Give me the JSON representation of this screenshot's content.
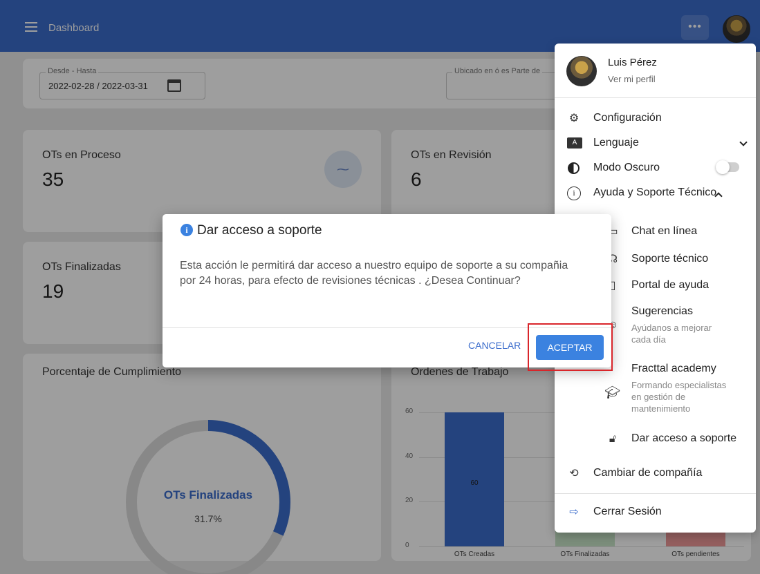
{
  "topbar": {
    "title": "Dashboard",
    "more_label": "•••"
  },
  "filters": {
    "date_range_label": "Desde - Hasta",
    "date_range_value": "2022-02-28 / 2022-03-31",
    "location_label": "Ubicado en ó es Parte de"
  },
  "cards": {
    "in_process": {
      "title": "OTs en Proceso",
      "value": "35"
    },
    "in_review": {
      "title": "OTs en Revisión",
      "value": "6"
    },
    "finished": {
      "title": "OTs Finalizadas",
      "value": "19"
    },
    "compliance": {
      "title": "Porcentaje de Cumplimiento",
      "donut_label": "OTs Finalizadas",
      "donut_percent": "31.7%",
      "donut_fraction": 0.317
    },
    "work_orders": {
      "title": "Ordenes de Trabajo"
    }
  },
  "chart_data": {
    "type": "bar",
    "title": "Ordenes de Trabajo",
    "categories": [
      "OTs Creadas",
      "OTs Finalizadas",
      "OTs pendientes"
    ],
    "values": [
      60
    ],
    "data_labels": [
      "60"
    ],
    "yticks": [
      "60",
      "40",
      "20",
      "0"
    ],
    "ylim": [
      0,
      60
    ],
    "colors": [
      "#3b6ccc",
      "#c8e6c9",
      "#ef9a9a"
    ]
  },
  "menu": {
    "user_name": "Luis Pérez",
    "profile_link": "Ver mi perfil",
    "settings": "Configuración",
    "language": "Lenguaje",
    "language_icon": "A",
    "dark_mode": "Modo Oscuro",
    "help": "Ayuda y Soporte Técnico",
    "chat": "Chat en línea",
    "tech_support": "Soporte técnico",
    "help_portal": "Portal de ayuda",
    "suggestions": "Sugerencias",
    "suggestions_desc_1": "Ayúdanos a mejorar",
    "suggestions_desc_2": "cada día",
    "academy": "Fracttal academy",
    "academy_desc_1": "Formando especialistas",
    "academy_desc_2": "en gestión de",
    "academy_desc_3": "mantenimiento",
    "support_access": "Dar acceso a soporte",
    "change_company": "Cambiar de compañía",
    "logout": "Cerrar Sesión"
  },
  "dialog": {
    "icon": "i",
    "title": "Dar acceso a soporte",
    "body": "Esta acción le permitirá dar acceso a nuestro equipo de soporte a su compañia por 24 horas, para efecto de revisiones técnicas . ¿Desea Continuar?",
    "cancel_label": "CANCELAR",
    "accept_label": "ACEPTAR"
  },
  "colors": {
    "primary": "#3b6ccc",
    "accent": "#3b82e0",
    "highlight": "#d9252a"
  }
}
